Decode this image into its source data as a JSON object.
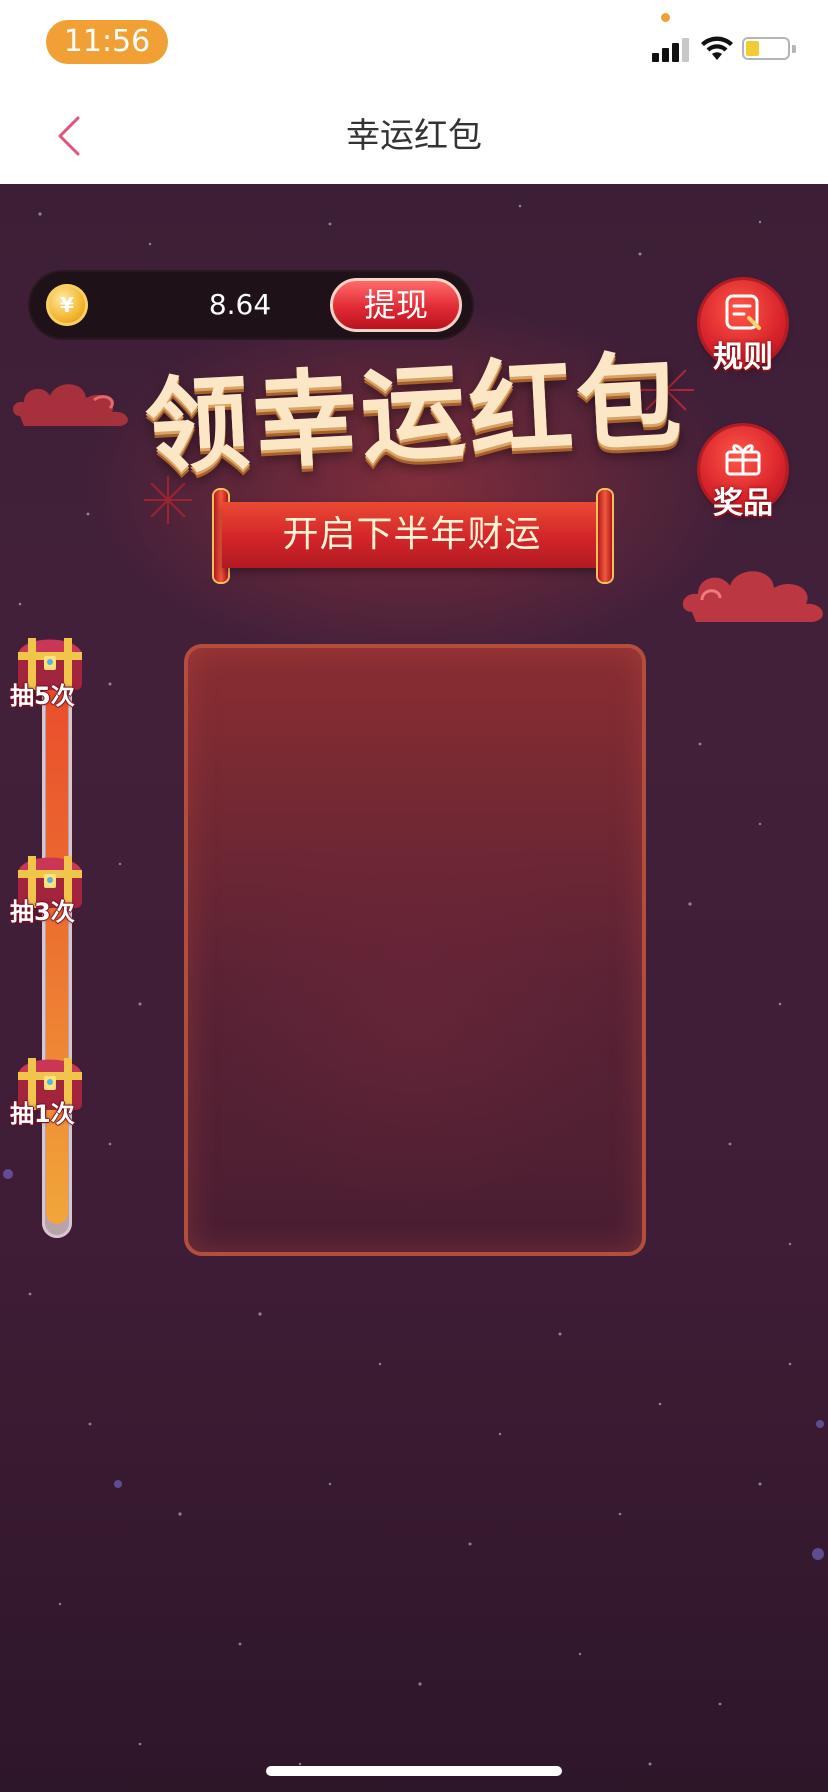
{
  "status_bar": {
    "time": "11:56"
  },
  "nav": {
    "title": "幸运红包",
    "back_icon": "chevron-left-icon",
    "accent_color": "#e8507a"
  },
  "balance": {
    "amount": "8.64",
    "coin_symbol": "¥",
    "withdraw_label": "提现"
  },
  "side_buttons": {
    "rules_label": "规则",
    "prizes_label": "奖品"
  },
  "title": {
    "main": "领幸运红包",
    "banner": "开启下半年财运"
  },
  "milestones": [
    {
      "label": "抽5次"
    },
    {
      "label": "抽3次"
    },
    {
      "label": "抽1次"
    }
  ],
  "colors": {
    "background": "#3c1f36",
    "primary_red": "#d8232b",
    "gold": "#f3b52d",
    "progress_top": "#e9472c",
    "progress_bottom": "#f1a63a"
  }
}
